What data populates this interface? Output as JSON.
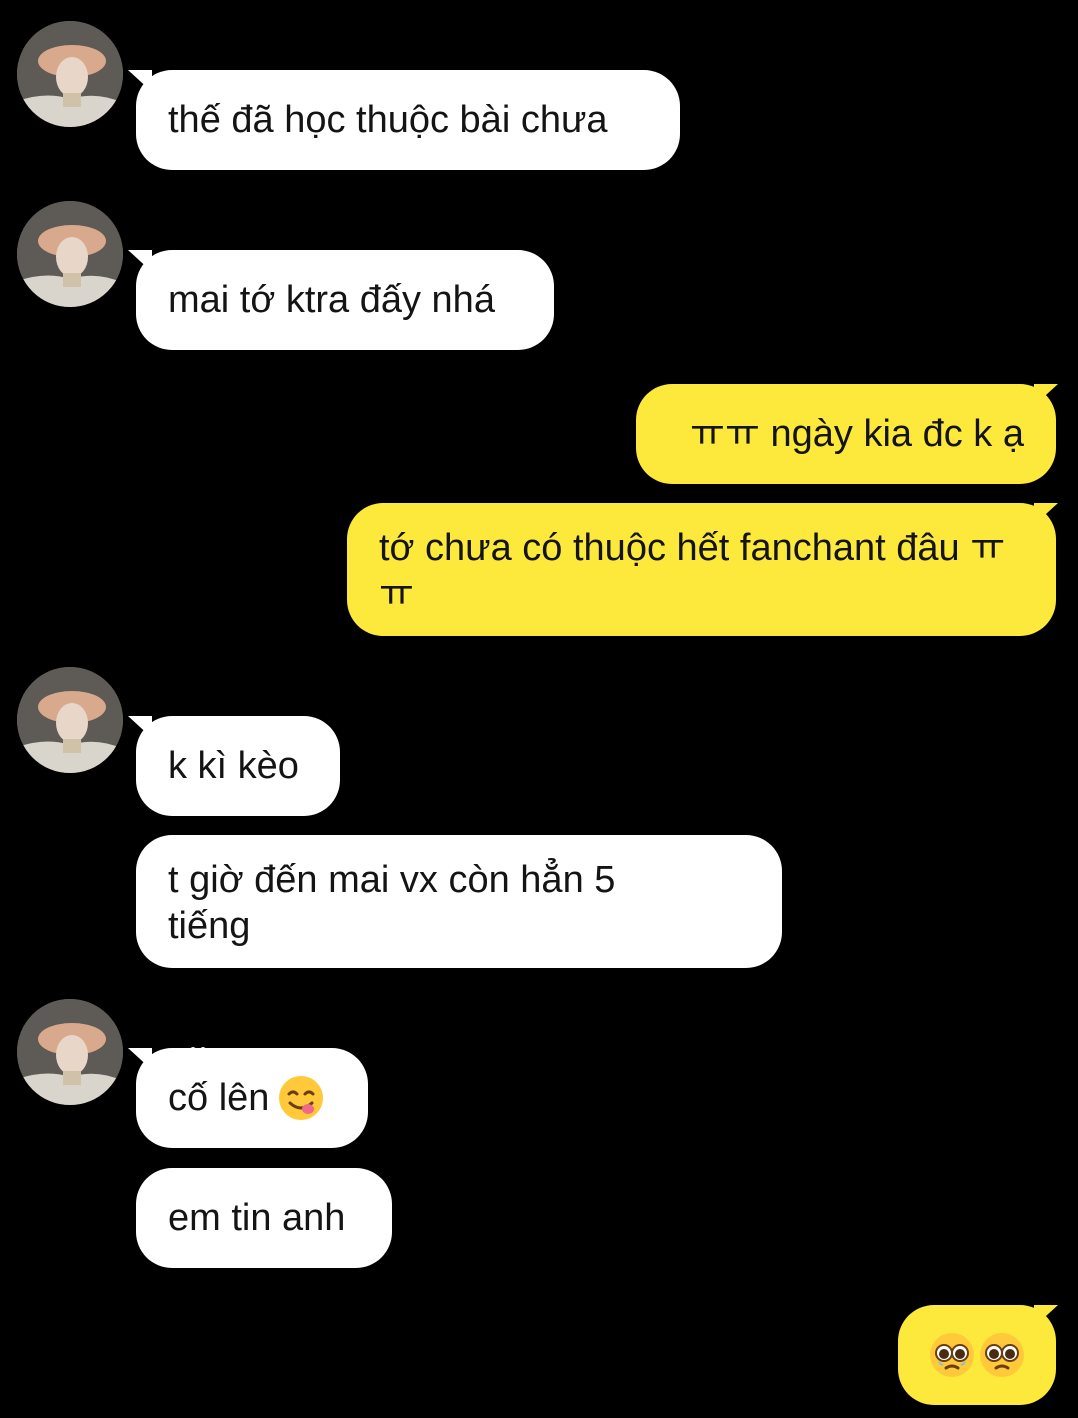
{
  "chat": {
    "messages": [
      {
        "sender": "other",
        "text": "thế đã học thuộc bài chưa"
      },
      {
        "sender": "other",
        "text": "mai tớ ktra đấy nhá"
      },
      {
        "sender": "me",
        "text": "ㅠㅠ ngày kia đc k ạ"
      },
      {
        "sender": "me",
        "text": "tớ chưa có thuộc hết fanchant đâu ㅠㅠ"
      },
      {
        "sender": "other",
        "text": "k kì kèo"
      },
      {
        "sender": "other",
        "text": "t giờ đến mai vx còn hẳn 5 tiếng"
      },
      {
        "sender": "other",
        "text": "cố lên"
      },
      {
        "sender": "other",
        "text": "em tin anh"
      },
      {
        "sender": "me",
        "text": ""
      }
    ],
    "emojis": {
      "m7": "face-savoring-food-icon",
      "m9": [
        "pleading-face-crying-icon",
        "pleading-face-icon"
      ]
    },
    "colors": {
      "background": "#000000",
      "incoming_bubble": "#ffffff",
      "outgoing_bubble": "#fde93b",
      "text": "#141414"
    }
  }
}
